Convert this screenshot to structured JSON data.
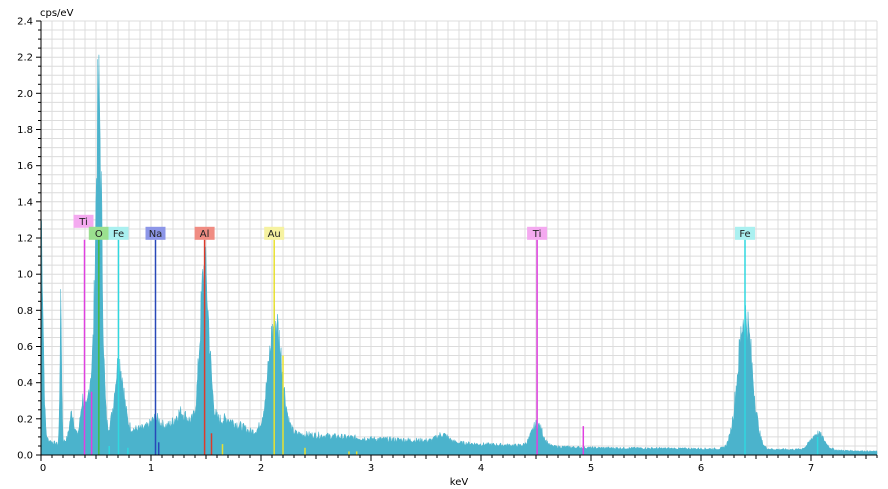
{
  "chart_data": {
    "type": "area",
    "ylabel": "cps/eV",
    "xlabel": "keV",
    "xlim": [
      0,
      7.6
    ],
    "ylim": [
      0,
      2.4
    ],
    "x_ticks": [
      0,
      1,
      2,
      3,
      4,
      5,
      6,
      7
    ],
    "y_ticks": [
      0.0,
      0.2,
      0.4,
      0.6,
      0.8,
      1.0,
      1.2,
      1.4,
      1.6,
      1.8,
      2.0,
      2.2,
      2.4
    ],
    "grid": true,
    "spectrum_color": "#4bb3cc",
    "spectrum": {
      "background": [
        [
          0,
          0.1
        ],
        [
          0.15,
          0.06
        ],
        [
          0.3,
          0.1
        ],
        [
          0.8,
          0.14
        ],
        [
          1.2,
          0.16
        ],
        [
          1.7,
          0.2
        ],
        [
          1.9,
          0.13
        ],
        [
          2.5,
          0.11
        ],
        [
          3,
          0.09
        ],
        [
          3.5,
          0.08
        ],
        [
          4,
          0.06
        ],
        [
          4.5,
          0.05
        ],
        [
          5,
          0.04
        ],
        [
          6,
          0.035
        ],
        [
          7,
          0.03
        ],
        [
          7.6,
          0.02
        ]
      ],
      "peaks": [
        {
          "center": 0.0,
          "height": 1.22,
          "width": 0.018
        },
        {
          "center": 0.18,
          "height": 0.72,
          "width": 0.008
        },
        {
          "center": 0.28,
          "height": 0.14,
          "width": 0.02
        },
        {
          "center": 0.38,
          "height": 0.2,
          "width": 0.02
        },
        {
          "center": 0.45,
          "height": 0.28,
          "width": 0.025
        },
        {
          "center": 0.525,
          "height": 1.84,
          "width": 0.028
        },
        {
          "center": 0.71,
          "height": 0.38,
          "width": 0.04
        },
        {
          "center": 1.04,
          "height": 0.05,
          "width": 0.04
        },
        {
          "center": 1.27,
          "height": 0.07,
          "width": 0.05
        },
        {
          "center": 1.487,
          "height": 0.84,
          "width": 0.04
        },
        {
          "center": 2.13,
          "height": 0.62,
          "width": 0.06
        },
        {
          "center": 3.65,
          "height": 0.04,
          "width": 0.05
        },
        {
          "center": 4.51,
          "height": 0.12,
          "width": 0.05
        },
        {
          "center": 6.4,
          "height": 0.74,
          "width": 0.065
        },
        {
          "center": 7.06,
          "height": 0.09,
          "width": 0.06
        }
      ]
    },
    "element_lines": [
      {
        "label": "Ti",
        "energy": 0.395,
        "height": 1.19,
        "color": "#e040e0"
      },
      {
        "label": "O",
        "energy": 0.525,
        "height": 1.19,
        "color": "#44bb44"
      },
      {
        "label": "Fe",
        "energy": 0.705,
        "height": 1.19,
        "color": "#30d8e0"
      },
      {
        "label": "Na",
        "energy": 1.041,
        "height": 1.19,
        "color": "#2848b8"
      },
      {
        "label": "Al",
        "energy": 1.487,
        "height": 1.19,
        "color": "#dd3a2a"
      },
      {
        "label": "Au",
        "energy": 2.12,
        "height": 1.19,
        "color": "#e8e030"
      },
      {
        "label": "Ti",
        "energy": 4.51,
        "height": 1.19,
        "color": "#e040e0"
      },
      {
        "label": "Fe",
        "energy": 6.4,
        "height": 1.19,
        "color": "#30d8e0"
      }
    ],
    "label_colors": {
      "Ti": "#f4aaf0",
      "O": "#9be08f",
      "Fe": "#aaf0f0",
      "Na": "#8c96e8",
      "Al": "#f08c82",
      "Au": "#f6f2a0"
    },
    "minor_lines": [
      {
        "energy": 0.46,
        "height": 0.35,
        "color": "#e040e0"
      },
      {
        "energy": 0.62,
        "height": 0.05,
        "color": "#30d8e0"
      },
      {
        "energy": 0.79,
        "height": 0.04,
        "color": "#30d8e0"
      },
      {
        "energy": 1.07,
        "height": 0.07,
        "color": "#2848b8"
      },
      {
        "energy": 1.55,
        "height": 0.12,
        "color": "#dd3a2a"
      },
      {
        "energy": 1.65,
        "height": 0.06,
        "color": "#e8e030"
      },
      {
        "energy": 2.2,
        "height": 0.55,
        "color": "#e8e030"
      },
      {
        "energy": 2.4,
        "height": 0.04,
        "color": "#e8e030"
      },
      {
        "energy": 2.8,
        "height": 0.02,
        "color": "#e8e030"
      },
      {
        "energy": 2.87,
        "height": 0.02,
        "color": "#e8e030"
      },
      {
        "energy": 4.93,
        "height": 0.16,
        "color": "#e040e0"
      },
      {
        "energy": 7.06,
        "height": 0.1,
        "color": "#30d8e0"
      }
    ]
  }
}
